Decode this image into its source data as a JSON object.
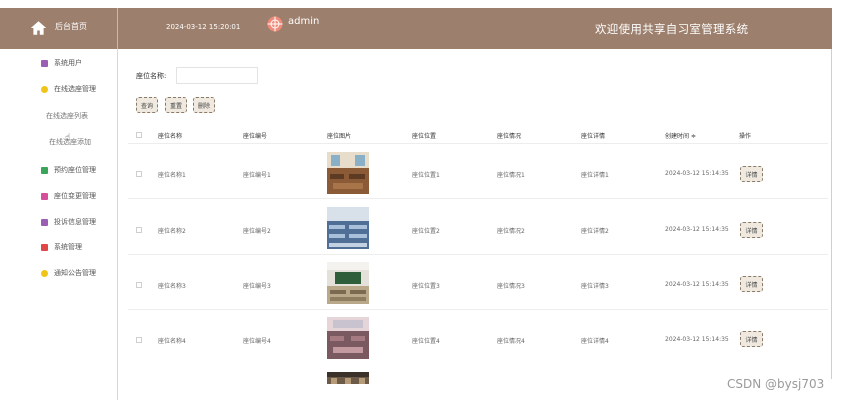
{
  "header": {
    "brand_label": "后台首页",
    "datetime": "2024-03-12 15:20:01",
    "user": "admin",
    "welcome": "欢迎使用共享自习室管理系统",
    "bar_color": "#9c7f6c"
  },
  "sidebar": {
    "items": [
      {
        "label": "系统用户",
        "icon": "user-icon",
        "color": "#9a5fb5"
      },
      {
        "label": "在线选座管理",
        "icon": "seat-icon",
        "color": "#f0c419"
      },
      {
        "label": "预约座位管理",
        "icon": "calendar-icon",
        "color": "#3aa55a"
      },
      {
        "label": "座位变更管理",
        "icon": "swap-icon",
        "color": "#d64f9a"
      },
      {
        "label": "投诉信息管理",
        "icon": "complaint-icon",
        "color": "#9a5fb5"
      },
      {
        "label": "系统管理",
        "icon": "grid-icon",
        "color": "#e04848"
      },
      {
        "label": "通知公告管理",
        "icon": "notice-icon",
        "color": "#f0c419"
      }
    ],
    "sub_items": [
      "在线选座列表",
      "在线选座添加"
    ]
  },
  "search": {
    "label": "座位名称:",
    "value": "",
    "buttons": [
      "查询",
      "重置",
      "删除"
    ]
  },
  "table": {
    "columns": [
      "座位名称",
      "座位编号",
      "座位图片",
      "座位位置",
      "座位情况",
      "座位详情",
      "创建时间 ≑",
      "操作"
    ],
    "rows": [
      {
        "name": "座位名称1",
        "code": "座位编号1",
        "position": "座位位置1",
        "status": "座位情况1",
        "detail": "座位详情1",
        "created": "2024-03-12 15:14:35",
        "action": "详情"
      },
      {
        "name": "座位名称2",
        "code": "座位编号2",
        "position": "座位位置2",
        "status": "座位情况2",
        "detail": "座位详情2",
        "created": "2024-03-12 15:14:35",
        "action": "详情"
      },
      {
        "name": "座位名称3",
        "code": "座位编号3",
        "position": "座位位置3",
        "status": "座位情况3",
        "detail": "座位详情3",
        "created": "2024-03-12 15:14:35",
        "action": "详情"
      },
      {
        "name": "座位名称4",
        "code": "座位编号4",
        "position": "座位位置4",
        "status": "座位情况4",
        "detail": "座位详情4",
        "created": "2024-03-12 15:14:35",
        "action": "详情"
      }
    ]
  },
  "watermark": "CSDN @bysj703"
}
